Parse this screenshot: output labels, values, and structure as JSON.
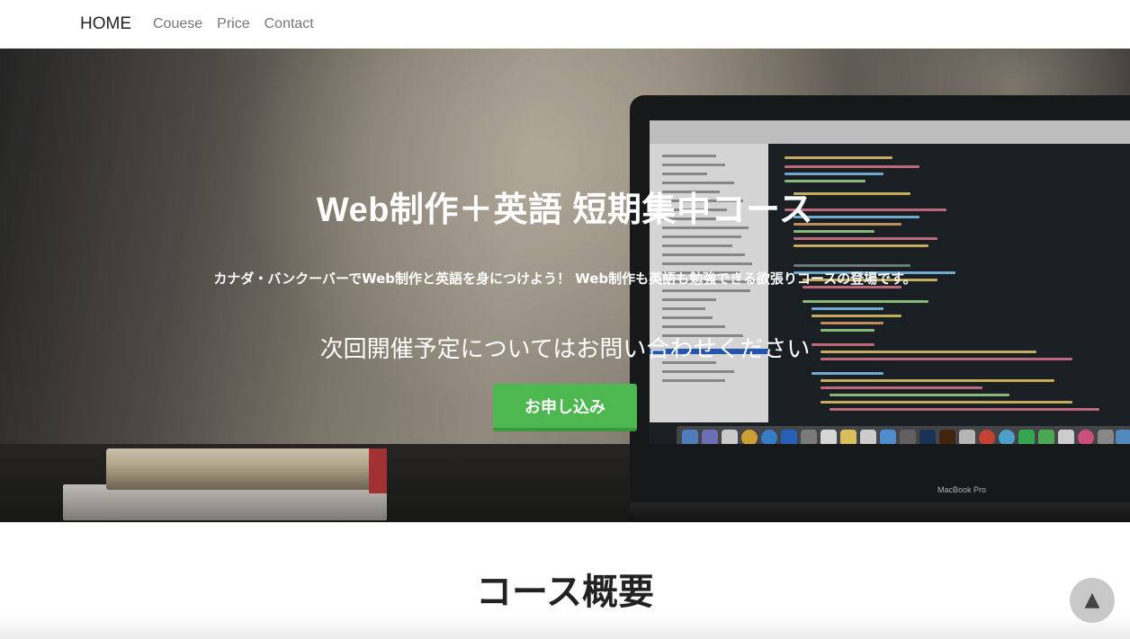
{
  "navbar": {
    "brand": "HOME",
    "links": [
      "Couese",
      "Price",
      "Contact"
    ]
  },
  "hero": {
    "title": "Web制作＋英語 短期集中コース",
    "lead": "カナダ・バンクーバーでWeb制作と英語を身につけよう！ Web制作も英語も勉強できる欲張りコースの登場です。",
    "subtitle": "次回開催予定についてはお問い合わせください",
    "button_label": "お申し込み",
    "button_color": "#4cb84f",
    "laptop_label": "MacBook Pro"
  },
  "section": {
    "title": "コース概要"
  },
  "back_to_top": {
    "icon": "triangle-up-icon",
    "glyph": "▲"
  }
}
